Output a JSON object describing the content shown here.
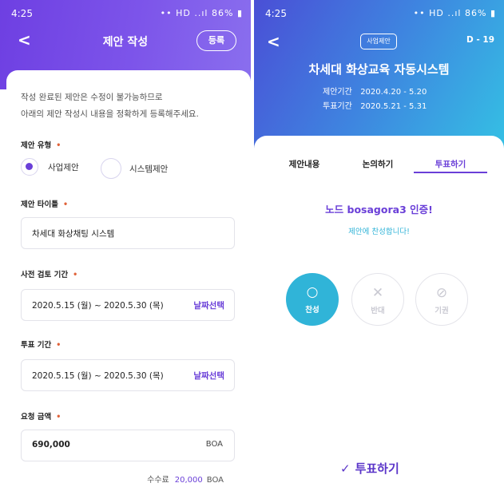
{
  "left": {
    "status": {
      "time": "4:25",
      "icons": "•• HD ..ıl",
      "battery": "86%"
    },
    "header": {
      "title": "제안 작성",
      "register_label": "등록"
    },
    "notice_lines": [
      "작성 완료된 제안은 수정이 불가능하므로",
      "아래의 제안 작성시 내용을 정확하게 등록해주세요."
    ],
    "type": {
      "label": "제안 유형",
      "options": [
        "사업제안",
        "시스템제안"
      ],
      "selected": "사업제안"
    },
    "title_field": {
      "label": "제안 타이틀",
      "value": "차세대 화상채팅 시스템"
    },
    "review": {
      "label": "사전 검토 기간",
      "value": "2020.5.15 (월) ~ 2020.5.30 (목)",
      "action": "날짜선택"
    },
    "vote_period": {
      "label": "투표 기간",
      "value": "2020.5.15 (월) ~ 2020.5.30 (목)",
      "action": "날짜선택"
    },
    "amount": {
      "label": "요청 금액",
      "value": "690,000",
      "unit": "BOA"
    },
    "fee": {
      "label": "수수료",
      "value": "20,000",
      "unit": "BOA"
    },
    "required_mark": "•"
  },
  "right": {
    "status": {
      "time": "4:25",
      "icons": "•• HD ..ıl",
      "battery": "86%"
    },
    "header": {
      "badge": "사업제안",
      "dday": "D - 19",
      "title": "차세대 화상교육 자동시스템",
      "proposal_period_label": "제안기간",
      "proposal_period": "2020.4.20 - 5.20",
      "vote_period_label": "투표기간",
      "vote_period": "2020.5.21 - 5.31"
    },
    "tabs": [
      "제안내용",
      "논의하기",
      "투표하기"
    ],
    "active_tab": "투표하기",
    "auth_message": "노드 bosagora3  인증!",
    "auth_sub": "제안에 찬성합니다!",
    "votes": [
      {
        "icon": "○",
        "label": "찬성",
        "selected": true
      },
      {
        "icon": "✕",
        "label": "반대",
        "selected": false
      },
      {
        "icon": "⊘",
        "label": "기권",
        "selected": false
      }
    ],
    "submit_label": "투표하기",
    "submit_icon": "✓"
  }
}
